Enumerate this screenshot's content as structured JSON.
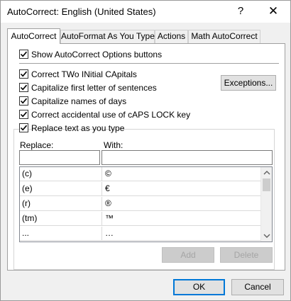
{
  "window": {
    "title": "AutoCorrect: English (United States)",
    "help_glyph": "?",
    "close_glyph": "✕"
  },
  "tabs": [
    {
      "label": "AutoCorrect",
      "active": true
    },
    {
      "label": "AutoFormat As You Type",
      "active": false
    },
    {
      "label": "Actions",
      "active": false
    },
    {
      "label": "Math AutoCorrect",
      "active": false
    }
  ],
  "options": {
    "show_buttons": {
      "label": "Show AutoCorrect Options buttons",
      "checked": true
    },
    "two_initial_caps": {
      "label": "Correct TWo INitial CApitals",
      "checked": true
    },
    "capitalize_first": {
      "label": "Capitalize first letter of sentences",
      "checked": true
    },
    "capitalize_days": {
      "label": "Capitalize names of days",
      "checked": true
    },
    "caps_lock": {
      "label": "Correct accidental use of cAPS LOCK key",
      "checked": true
    },
    "replace_text": {
      "label": "Replace text as you type",
      "checked": true
    }
  },
  "exceptions_label": "Exceptions...",
  "replace_section": {
    "replace_label": "Replace:",
    "with_label": "With:",
    "replace_value": "",
    "with_value": ""
  },
  "entries": [
    {
      "replace": "(c)",
      "with": "©"
    },
    {
      "replace": "(e)",
      "with": "€"
    },
    {
      "replace": "(r)",
      "with": "®"
    },
    {
      "replace": "(tm)",
      "with": "™"
    },
    {
      "replace": "...",
      "with": "…"
    }
  ],
  "list_buttons": {
    "add": "Add",
    "delete": "Delete"
  },
  "footer": {
    "ok": "OK",
    "cancel": "Cancel"
  }
}
